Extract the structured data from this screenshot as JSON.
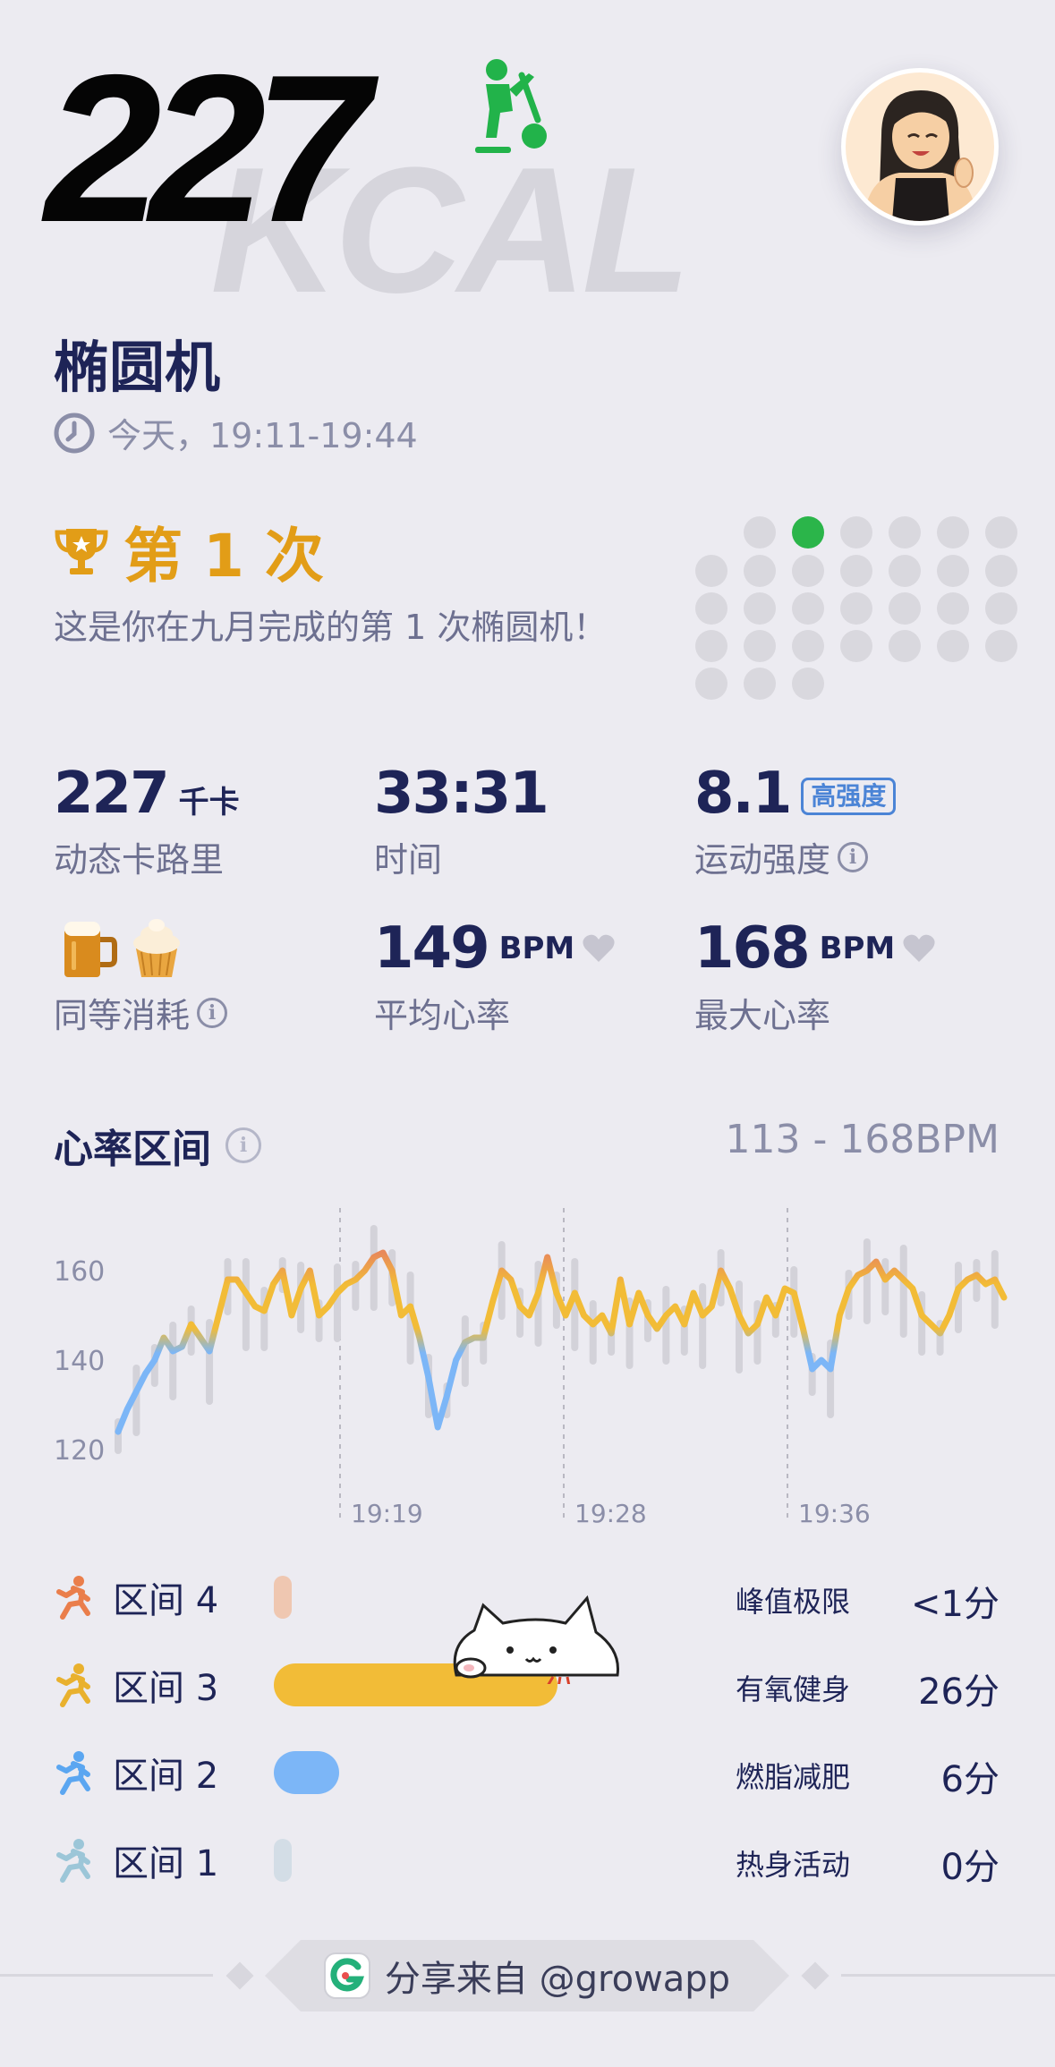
{
  "hero": {
    "number": "227",
    "unit_bg": "KCAL"
  },
  "workout": {
    "title": "椭圆机",
    "time": "今天，19:11-19:44"
  },
  "achievement": {
    "rank": "第 1 次",
    "description": "这是你在九月完成的第 1 次椭圆机！"
  },
  "stats": {
    "calories": {
      "value": "227",
      "unit": "千卡",
      "label": "动态卡路里"
    },
    "duration": {
      "value": "33:31",
      "label": "时间"
    },
    "intensity": {
      "value": "8.1",
      "badge": "高强度",
      "label": "运动强度"
    },
    "equivalent": {
      "label": "同等消耗"
    },
    "avg_hr": {
      "value": "149",
      "unit": "BPM",
      "label": "平均心率"
    },
    "max_hr": {
      "value": "168",
      "unit": "BPM",
      "label": "最大心率"
    }
  },
  "heart_rate": {
    "title": "心率区间",
    "range": "113 - 168BPM"
  },
  "chart_data": {
    "type": "line",
    "y_ticks": [
      "160",
      "140",
      "120"
    ],
    "x_ticks": [
      "19:19",
      "19:28",
      "19:36"
    ],
    "ylim": [
      112,
      172
    ],
    "values": [
      124,
      129,
      133,
      137,
      140,
      145,
      142,
      143,
      148,
      145,
      142,
      150,
      158,
      158,
      155,
      152,
      151,
      157,
      160,
      150,
      156,
      160,
      150,
      152,
      155,
      157,
      158,
      160,
      163,
      164,
      160,
      150,
      152,
      145,
      136,
      125,
      132,
      140,
      144,
      145,
      145,
      153,
      160,
      158,
      152,
      150,
      155,
      163,
      155,
      150,
      155,
      150,
      148,
      150,
      146,
      158,
      148,
      155,
      150,
      147,
      150,
      152,
      148,
      155,
      150,
      152,
      160,
      156,
      150,
      146,
      148,
      154,
      150,
      156,
      155,
      147,
      138,
      140,
      138,
      150,
      156,
      159,
      160,
      162,
      158,
      160,
      158,
      156,
      150,
      148,
      146,
      150,
      156,
      158,
      159,
      157,
      158,
      154
    ]
  },
  "zones": [
    {
      "name": "区间 4",
      "desc": "峰值极限",
      "minutes": "<1分",
      "fraction": 0.02,
      "color": "#efc7b1"
    },
    {
      "name": "区间 3",
      "desc": "有氧健身",
      "minutes": "26分",
      "fraction": 0.78,
      "color": "#f2bc37"
    },
    {
      "name": "区间 2",
      "desc": "燃脂减肥",
      "minutes": "6分",
      "fraction": 0.18,
      "color": "#7cb6f7"
    },
    {
      "name": "区间 1",
      "desc": "热身活动",
      "minutes": "0分",
      "fraction": 0.0,
      "color": "#d3dde6"
    }
  ],
  "footer": {
    "text": "分享来自 @growapp"
  }
}
